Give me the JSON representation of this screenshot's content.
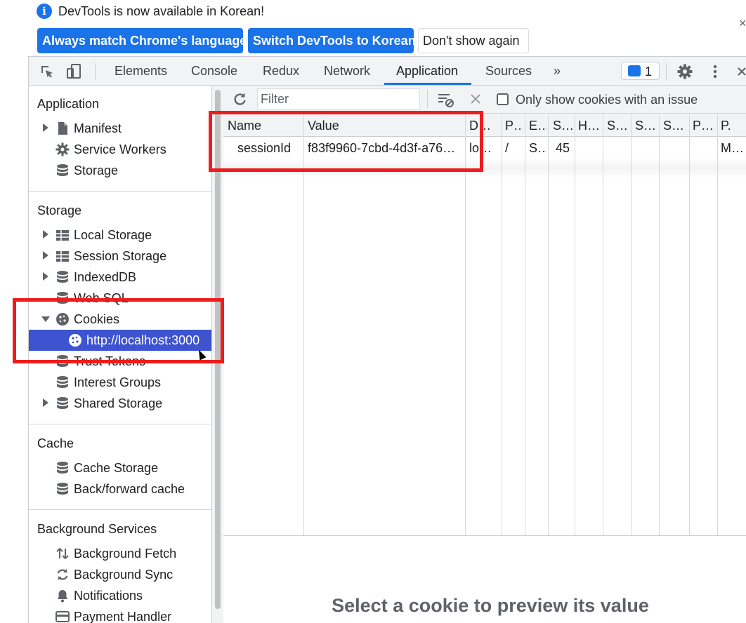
{
  "infobar": {
    "message": "DevTools is now available in Korean!",
    "info_glyph": "i",
    "close_glyph": "×",
    "buttons": {
      "match_language": "Always match Chrome's language",
      "switch_language": "Switch DevTools to Korean",
      "dont_show": "Don't show again"
    }
  },
  "main_tabs": {
    "items": [
      "Elements",
      "Console",
      "Redux",
      "Network",
      "Application",
      "Sources"
    ],
    "active": "Application",
    "more_glyph": "»",
    "issues_count": "1"
  },
  "sidebar": {
    "sections": {
      "application": {
        "title": "Application",
        "items": [
          "Manifest",
          "Service Workers",
          "Storage"
        ]
      },
      "storage": {
        "title": "Storage",
        "items": [
          "Local Storage",
          "Session Storage",
          "IndexedDB",
          "Web SQL",
          "Cookies",
          "http://localhost:3000",
          "Trust Tokens",
          "Interest Groups",
          "Shared Storage"
        ]
      },
      "cache": {
        "title": "Cache",
        "items": [
          "Cache Storage",
          "Back/forward cache"
        ]
      },
      "background": {
        "title": "Background Services",
        "items": [
          "Background Fetch",
          "Background Sync",
          "Notifications",
          "Payment Handler"
        ]
      }
    },
    "selected": "http://localhost:3000"
  },
  "cookie_toolbar": {
    "filter_placeholder": "Filter",
    "only_issues_label": "Only show cookies with an issue",
    "only_issues_checked": false
  },
  "cookie_table": {
    "columns": [
      "Name",
      "Value",
      "D…",
      "P…",
      "E…",
      "S…",
      "H…",
      "S…",
      "S…",
      "S…",
      "P…",
      "P."
    ],
    "rows": [
      [
        "sessionId",
        "f83f9960-7cbd-4d3f-a76…",
        "lo…",
        "/",
        "S…",
        "45",
        "",
        "",
        "",
        "",
        "",
        "M…"
      ]
    ]
  },
  "preview": {
    "empty_message": "Select a cookie to preview its value"
  },
  "colors": {
    "accent": "#1a73e8",
    "selection": "#3d53cf",
    "annotation": "#ee1c1c"
  }
}
